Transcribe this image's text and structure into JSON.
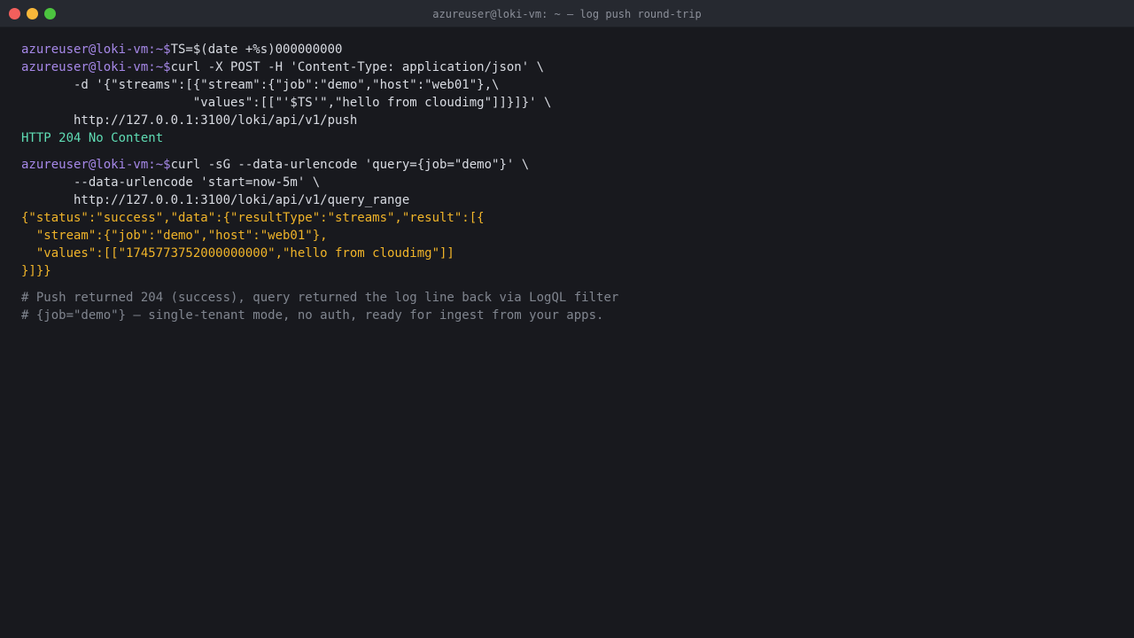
{
  "window": {
    "title": "azureuser@loki-vm: ~ — log push round-trip",
    "controls": [
      {
        "name": "close",
        "color": "#f25f5c"
      },
      {
        "name": "minimize",
        "color": "#f7b73a"
      },
      {
        "name": "maximize",
        "color": "#4cc43f"
      }
    ]
  },
  "colors": {
    "background": "#18191e",
    "prompt": "#a688e8",
    "success": "#5fdcb4",
    "json": "#f0b429",
    "comment": "#80858f"
  },
  "terminal": {
    "prompt": "azureuser@loki-vm:~$",
    "block1": {
      "cmd1": "TS=$(date +%s)000000000",
      "cmd2": "curl -X POST -H 'Content-Type: application/json' \\",
      "cont1": "       -d '{\"streams\":[{\"stream\":{\"job\":\"demo\",\"host\":\"web01\"},\\",
      "cont2": "                       \"values\":[[\"'$TS'\",\"hello from cloudimg\"]]}]}' \\",
      "cont3": "       http://127.0.0.1:3100/loki/api/v1/push",
      "response": "HTTP 204 No Content"
    },
    "block2": {
      "cmd": "curl -sG --data-urlencode 'query={job=\"demo\"}' \\",
      "cont1": "       --data-urlencode 'start=now-5m' \\",
      "cont2": "       http://127.0.0.1:3100/loki/api/v1/query_range",
      "json1": "{\"status\":\"success\",\"data\":{\"resultType\":\"streams\",\"result\":[{",
      "json2": "  \"stream\":{\"job\":\"demo\",\"host\":\"web01\"},",
      "json3": "  \"values\":[[\"1745773752000000000\",\"hello from cloudimg\"]]",
      "json4": "}]}}"
    },
    "comments": {
      "line1": "# Push returned 204 (success), query returned the log line back via LogQL filter",
      "line2": "# {job=\"demo\"} — single-tenant mode, no auth, ready for ingest from your apps."
    }
  }
}
